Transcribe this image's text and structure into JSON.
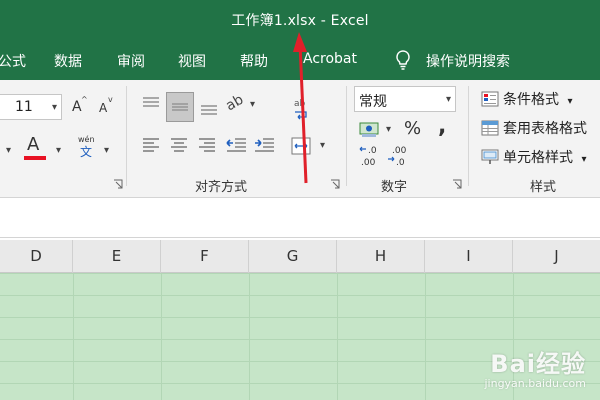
{
  "window": {
    "title": "工作簿1.xlsx  -  Excel"
  },
  "menu": {
    "tabs": [
      "公式",
      "数据",
      "审阅",
      "视图",
      "帮助",
      "Acrobat"
    ],
    "tell_me": "操作说明搜索"
  },
  "ribbon": {
    "font": {
      "size": "11",
      "grow_label": "A",
      "shrink_label": "A",
      "color_label": "A",
      "phonetic_top": "wén",
      "phonetic_bottom": "文"
    },
    "alignment": {
      "label": "对齐方式",
      "orientation_label": "ab"
    },
    "number": {
      "label": "数字",
      "format": "常规",
      "percent": "%",
      "comma": ",",
      "inc_decimal": ".0\n.00",
      "dec_decimal": ".00\n.0"
    },
    "styles": {
      "label": "样式",
      "conditional": "条件格式",
      "table": "套用表格格式",
      "cell": "单元格样式"
    },
    "colors": {
      "font_color_bar": "#e81123",
      "accent": "#217346"
    }
  },
  "grid": {
    "columns": [
      "D",
      "E",
      "F",
      "G",
      "H",
      "I",
      "J"
    ]
  },
  "watermark": {
    "brand": "Bai经验",
    "url": "jingyan.baidu.com"
  }
}
